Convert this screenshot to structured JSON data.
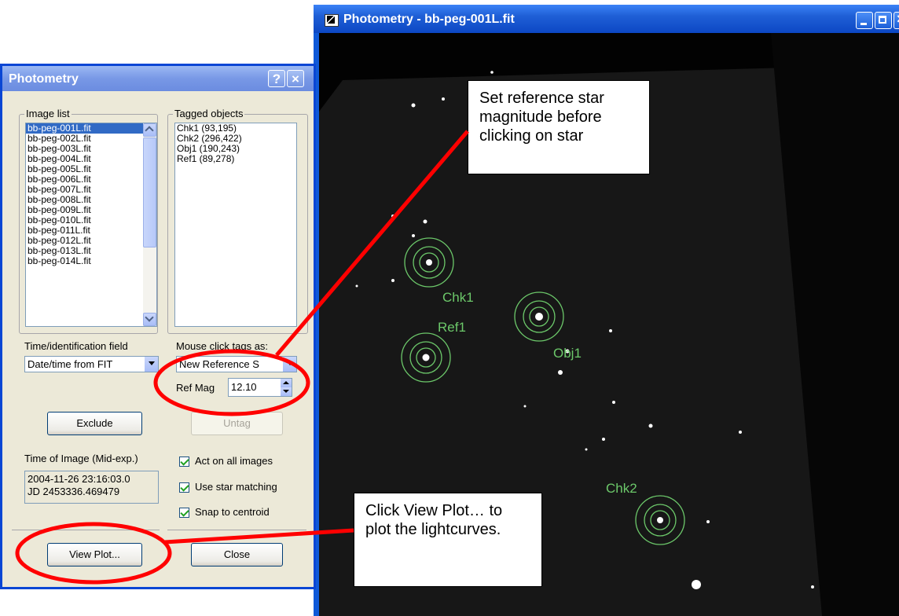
{
  "image_window": {
    "title": "Photometry - bb-peg-001L.fit",
    "tags": [
      {
        "label": "Chk1"
      },
      {
        "label": "Ref1"
      },
      {
        "label": "Obj1"
      },
      {
        "label": "Chk2"
      }
    ]
  },
  "dialog": {
    "title": "Photometry",
    "help_button": "?",
    "close_glyph": "×",
    "image_list": {
      "legend": "Image list",
      "items": [
        "bb-peg-001L.fit",
        "bb-peg-002L.fit",
        "bb-peg-003L.fit",
        "bb-peg-004L.fit",
        "bb-peg-005L.fit",
        "bb-peg-006L.fit",
        "bb-peg-007L.fit",
        "bb-peg-008L.fit",
        "bb-peg-009L.fit",
        "bb-peg-010L.fit",
        "bb-peg-011L.fit",
        "bb-peg-012L.fit",
        "bb-peg-013L.fit",
        "bb-peg-014L.fit"
      ],
      "selected_index": 0
    },
    "tagged_objects": {
      "legend": "Tagged objects",
      "items": [
        "Chk1 (93,195)",
        "Chk2 (296,422)",
        "Obj1 (190,243)",
        "Ref1 (89,278)"
      ]
    },
    "time_field_label": "Time/identification field",
    "time_field_value": "Date/time from FIT",
    "mouse_click_label": "Mouse click tags as:",
    "mouse_click_value": "New Reference S",
    "ref_mag_label": "Ref Mag",
    "ref_mag_value": "12.10",
    "exclude_button": "Exclude",
    "untag_button": "Untag",
    "time_of_image_label": "Time of Image (Mid-exp.)",
    "time_of_image_line1": "2004-11-26  23:16:03.0",
    "time_of_image_line2": "JD 2453336.469479",
    "checkboxes": [
      {
        "label": "Act on all images",
        "checked": true
      },
      {
        "label": "Use star matching",
        "checked": true
      },
      {
        "label": "Snap to centroid",
        "checked": true
      }
    ],
    "view_plot_button": "View Plot...",
    "close_button": "Close"
  },
  "callouts": {
    "ref_star": "Set reference star magnitude before clicking on star",
    "view_plot": "Click View Plot… to plot the lightcurves."
  },
  "colors": {
    "annotation": "#ff0000",
    "tag_circle": "#6cc86a",
    "titlebar_active": "#0c47c4",
    "titlebar_inactive": "#7898e6"
  }
}
